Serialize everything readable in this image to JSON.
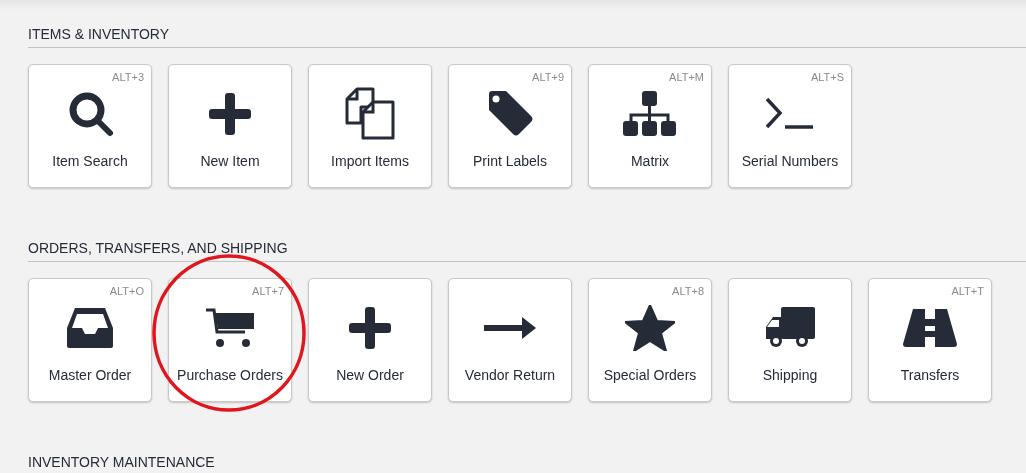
{
  "sections": [
    {
      "title": "ITEMS & INVENTORY",
      "tiles": [
        {
          "label": "Item Search",
          "shortcut": "ALT+3",
          "highlighted": false
        },
        {
          "label": "New Item",
          "highlighted": false
        },
        {
          "label": "Import Items",
          "highlighted": false
        },
        {
          "label": "Print Labels",
          "shortcut": "ALT+9",
          "highlighted": false
        },
        {
          "label": "Matrix",
          "shortcut": "ALT+M",
          "highlighted": false
        },
        {
          "label": "Serial Numbers",
          "shortcut": "ALT+S",
          "highlighted": false
        }
      ]
    },
    {
      "title": "ORDERS, TRANSFERS, AND SHIPPING",
      "tiles": [
        {
          "label": "Master Order",
          "shortcut": "ALT+O",
          "highlighted": false
        },
        {
          "label": "Purchase Orders",
          "shortcut": "ALT+7",
          "highlighted": true
        },
        {
          "label": "New Order",
          "highlighted": false
        },
        {
          "label": "Vendor Return",
          "highlighted": false
        },
        {
          "label": "Special Orders",
          "shortcut": "ALT+8",
          "highlighted": false
        },
        {
          "label": "Shipping",
          "highlighted": false
        },
        {
          "label": "Transfers",
          "shortcut": "ALT+T",
          "highlighted": false
        }
      ]
    },
    {
      "title": "INVENTORY MAINTENANCE"
    }
  ]
}
